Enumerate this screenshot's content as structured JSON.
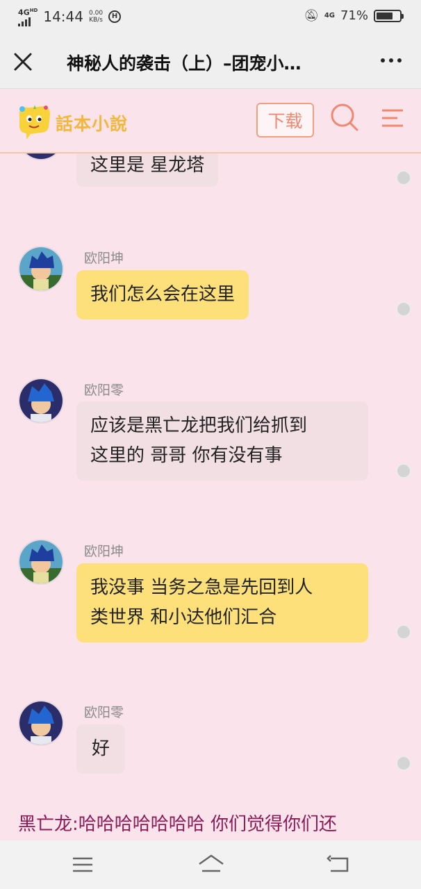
{
  "status_bar": {
    "network_type": "4G",
    "network_sup": "HD",
    "time": "14:44",
    "speed_value": "0.00",
    "speed_unit": "KB/s",
    "circle_glyph": "H",
    "net_right": "4G",
    "battery_percent": "71%",
    "battery_level": 0.71
  },
  "title_bar": {
    "title": "神秘人的袭击（上）–团宠小…"
  },
  "app_header": {
    "logo_text": "話本小說",
    "download_label": "下载"
  },
  "messages": [
    {
      "sender": "",
      "text": "这里是 星龙塔",
      "style": "pink",
      "avatar": "ouyanglin-avatar"
    },
    {
      "sender": "欧阳坤",
      "text": "我们怎么会在这里",
      "style": "yellow",
      "avatar": "ouyangkun-avatar"
    },
    {
      "sender": "欧阳零",
      "lines": [
        "应该是黑亡龙把我们给抓到",
        "这里的 哥哥 你有没有事"
      ],
      "style": "pink",
      "avatar": "ouyanglin-avatar"
    },
    {
      "sender": "欧阳坤",
      "lines": [
        "我没事 当务之急是先回到人",
        "类世界 和小达他们汇合"
      ],
      "style": "yellow",
      "avatar": "ouyangkun-avatar"
    },
    {
      "sender": "欧阳零",
      "text": "好",
      "style": "pink",
      "avatar": "ouyanglin-avatar"
    }
  ],
  "narration": "黑亡龙:哈哈哈哈哈哈哈 你们觉得你们还",
  "colors": {
    "background": "#fbe3ec",
    "bubble_yellow": "#fde07a",
    "bubble_pink": "#f1dfe4",
    "narration": "#8b1a56",
    "accent": "#f08870"
  },
  "icons": {
    "close": "close-icon",
    "more": "more-icon",
    "search": "search-icon",
    "menu": "menu-icon",
    "nav_menu": "nav-menu-icon",
    "nav_home": "nav-home-icon",
    "nav_back": "nav-back-icon"
  }
}
